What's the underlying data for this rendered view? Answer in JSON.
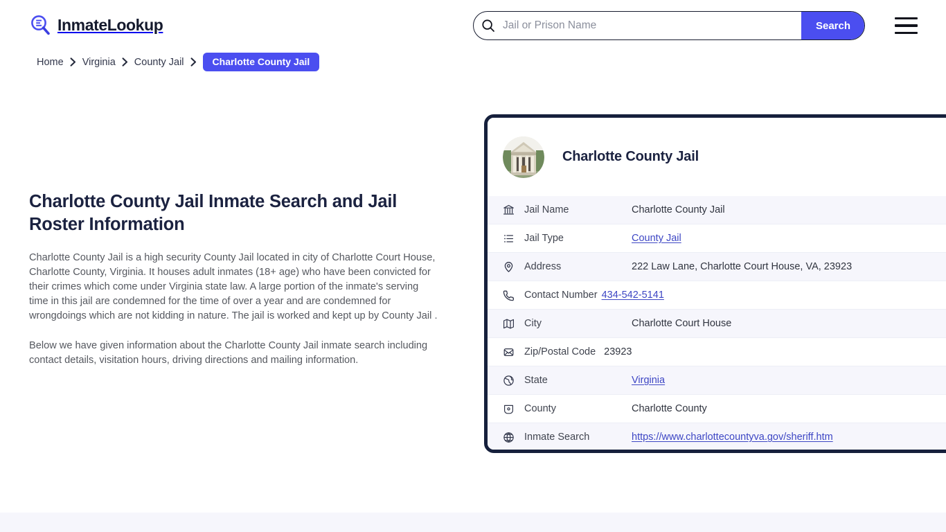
{
  "site": {
    "brand": "InmateLookup",
    "logo_icon": "magnifier-list-icon",
    "accent_color": "#4b4ef0",
    "dark_color": "#16203c"
  },
  "header": {
    "search": {
      "placeholder": "Jail or Prison Name",
      "value": "",
      "button_label": "Search",
      "icon": "search-icon"
    },
    "menu_icon": "hamburger-menu-icon"
  },
  "breadcrumb": {
    "items": [
      {
        "label": "Home",
        "current": false
      },
      {
        "label": "Virginia",
        "current": false
      },
      {
        "label": "County Jail",
        "current": false
      },
      {
        "label": "Charlotte County Jail",
        "current": true
      }
    ],
    "separator_icon": "chevron-right-icon"
  },
  "main": {
    "title": "Charlotte County Jail Inmate Search and Jail Roster Information",
    "paragraph_1": "Charlotte County Jail is a high security County Jail located in city of Charlotte Court House, Charlotte County, Virginia. It houses adult inmates (18+ age) who have been convicted for their crimes which come under Virginia state law. A large portion of the inmate's serving time in this jail are condemned for the time of over a year and are condemned for wrongdoings which are not kidding in nature. The jail is worked and kept up by County Jail .",
    "paragraph_2": "Below we have given information about the Charlotte County Jail inmate search including contact details, visitation hours, driving directions and mailing information."
  },
  "info_card": {
    "avatar_icon": "courthouse-photo",
    "title": "Charlotte County Jail",
    "rows": [
      {
        "icon": "bank-icon",
        "label": "Jail Name",
        "value": "Charlotte County Jail",
        "is_link": false
      },
      {
        "icon": "list-icon",
        "label": "Jail Type",
        "value": "County Jail",
        "is_link": true
      },
      {
        "icon": "map-pin-icon",
        "label": "Address",
        "value": "222 Law Lane, Charlotte Court House, VA, 23923",
        "is_link": false
      },
      {
        "icon": "phone-icon",
        "label": "Contact Number",
        "value": "434-542-5141",
        "is_link": true
      },
      {
        "icon": "map-icon",
        "label": "City",
        "value": "Charlotte Court House",
        "is_link": false
      },
      {
        "icon": "envelope-icon",
        "label": "Zip/Postal Code",
        "value": "23923",
        "is_link": false
      },
      {
        "icon": "globe-icon",
        "label": "State",
        "value": "Virginia",
        "is_link": true
      },
      {
        "icon": "shield-icon",
        "label": "County",
        "value": "Charlotte County",
        "is_link": false
      },
      {
        "icon": "web-icon",
        "label": "Inmate Search",
        "value": "https://www.charlottecountyva.gov/sheriff.htm",
        "is_link": true
      }
    ]
  }
}
